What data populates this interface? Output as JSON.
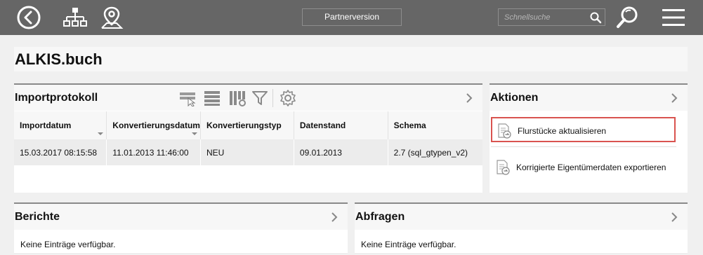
{
  "topbar": {
    "back_icon": "back-circle-icon",
    "network_icon": "sitemap-icon",
    "location_icon": "map-pin-icon",
    "partner_label": "Partnerversion",
    "search_placeholder": "Schnellsuche",
    "search_icon": "search-icon",
    "zoom_search_icon": "magnifier-icon",
    "menu_icon": "hamburger-menu-icon"
  },
  "page": {
    "title": "ALKIS.buch"
  },
  "importprotokoll": {
    "title": "Importprotokoll",
    "toolbar_icons": [
      "filter-select-icon",
      "list-rows-icon",
      "column-settings-icon",
      "funnel-icon",
      "gear-icon"
    ],
    "columns": [
      "Importdatum",
      "Konvertierungsdatum",
      "Konvertierungstyp",
      "Datenstand",
      "Schema"
    ],
    "rows": [
      [
        "15.03.2017 08:15:58",
        "11.01.2013 11:46:00",
        "NEU",
        "09.01.2013",
        "2.7 (sql_gtypen_v2)"
      ]
    ]
  },
  "aktionen": {
    "title": "Aktionen",
    "items": [
      {
        "label": "Flurstücke aktualisieren",
        "icon": "document-arrow-icon"
      },
      {
        "label": "Korrigierte Eigentümerdaten exportieren",
        "icon": "document-arrow-icon"
      }
    ]
  },
  "berichte": {
    "title": "Berichte",
    "empty_text": "Keine Einträge verfügbar."
  },
  "abfragen": {
    "title": "Abfragen",
    "empty_text": "Keine Einträge verfügbar."
  },
  "colors": {
    "topbar": "#666666",
    "highlight": "#d9534f",
    "panel_border": "#8a8a8a"
  }
}
